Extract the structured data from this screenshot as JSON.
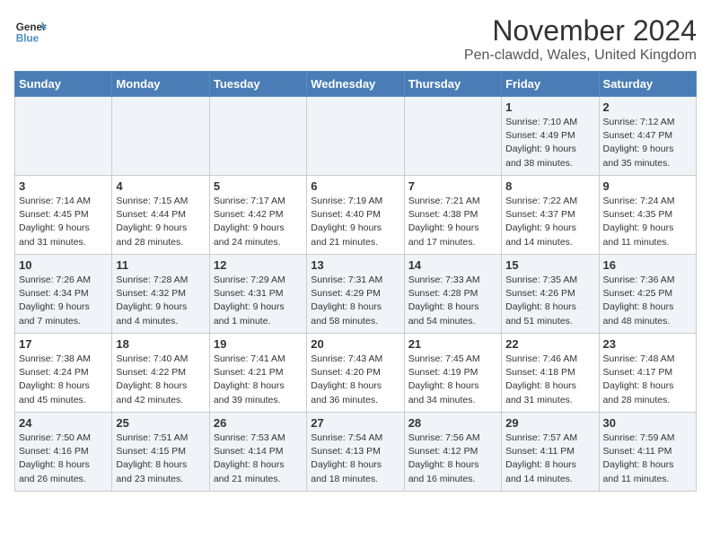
{
  "logo": {
    "line1": "General",
    "line2": "Blue"
  },
  "title": "November 2024",
  "location": "Pen-clawdd, Wales, United Kingdom",
  "days_header": [
    "Sunday",
    "Monday",
    "Tuesday",
    "Wednesday",
    "Thursday",
    "Friday",
    "Saturday"
  ],
  "weeks": [
    [
      {
        "day": "",
        "info": ""
      },
      {
        "day": "",
        "info": ""
      },
      {
        "day": "",
        "info": ""
      },
      {
        "day": "",
        "info": ""
      },
      {
        "day": "",
        "info": ""
      },
      {
        "day": "1",
        "info": "Sunrise: 7:10 AM\nSunset: 4:49 PM\nDaylight: 9 hours\nand 38 minutes."
      },
      {
        "day": "2",
        "info": "Sunrise: 7:12 AM\nSunset: 4:47 PM\nDaylight: 9 hours\nand 35 minutes."
      }
    ],
    [
      {
        "day": "3",
        "info": "Sunrise: 7:14 AM\nSunset: 4:45 PM\nDaylight: 9 hours\nand 31 minutes."
      },
      {
        "day": "4",
        "info": "Sunrise: 7:15 AM\nSunset: 4:44 PM\nDaylight: 9 hours\nand 28 minutes."
      },
      {
        "day": "5",
        "info": "Sunrise: 7:17 AM\nSunset: 4:42 PM\nDaylight: 9 hours\nand 24 minutes."
      },
      {
        "day": "6",
        "info": "Sunrise: 7:19 AM\nSunset: 4:40 PM\nDaylight: 9 hours\nand 21 minutes."
      },
      {
        "day": "7",
        "info": "Sunrise: 7:21 AM\nSunset: 4:38 PM\nDaylight: 9 hours\nand 17 minutes."
      },
      {
        "day": "8",
        "info": "Sunrise: 7:22 AM\nSunset: 4:37 PM\nDaylight: 9 hours\nand 14 minutes."
      },
      {
        "day": "9",
        "info": "Sunrise: 7:24 AM\nSunset: 4:35 PM\nDaylight: 9 hours\nand 11 minutes."
      }
    ],
    [
      {
        "day": "10",
        "info": "Sunrise: 7:26 AM\nSunset: 4:34 PM\nDaylight: 9 hours\nand 7 minutes."
      },
      {
        "day": "11",
        "info": "Sunrise: 7:28 AM\nSunset: 4:32 PM\nDaylight: 9 hours\nand 4 minutes."
      },
      {
        "day": "12",
        "info": "Sunrise: 7:29 AM\nSunset: 4:31 PM\nDaylight: 9 hours\nand 1 minute."
      },
      {
        "day": "13",
        "info": "Sunrise: 7:31 AM\nSunset: 4:29 PM\nDaylight: 8 hours\nand 58 minutes."
      },
      {
        "day": "14",
        "info": "Sunrise: 7:33 AM\nSunset: 4:28 PM\nDaylight: 8 hours\nand 54 minutes."
      },
      {
        "day": "15",
        "info": "Sunrise: 7:35 AM\nSunset: 4:26 PM\nDaylight: 8 hours\nand 51 minutes."
      },
      {
        "day": "16",
        "info": "Sunrise: 7:36 AM\nSunset: 4:25 PM\nDaylight: 8 hours\nand 48 minutes."
      }
    ],
    [
      {
        "day": "17",
        "info": "Sunrise: 7:38 AM\nSunset: 4:24 PM\nDaylight: 8 hours\nand 45 minutes."
      },
      {
        "day": "18",
        "info": "Sunrise: 7:40 AM\nSunset: 4:22 PM\nDaylight: 8 hours\nand 42 minutes."
      },
      {
        "day": "19",
        "info": "Sunrise: 7:41 AM\nSunset: 4:21 PM\nDaylight: 8 hours\nand 39 minutes."
      },
      {
        "day": "20",
        "info": "Sunrise: 7:43 AM\nSunset: 4:20 PM\nDaylight: 8 hours\nand 36 minutes."
      },
      {
        "day": "21",
        "info": "Sunrise: 7:45 AM\nSunset: 4:19 PM\nDaylight: 8 hours\nand 34 minutes."
      },
      {
        "day": "22",
        "info": "Sunrise: 7:46 AM\nSunset: 4:18 PM\nDaylight: 8 hours\nand 31 minutes."
      },
      {
        "day": "23",
        "info": "Sunrise: 7:48 AM\nSunset: 4:17 PM\nDaylight: 8 hours\nand 28 minutes."
      }
    ],
    [
      {
        "day": "24",
        "info": "Sunrise: 7:50 AM\nSunset: 4:16 PM\nDaylight: 8 hours\nand 26 minutes."
      },
      {
        "day": "25",
        "info": "Sunrise: 7:51 AM\nSunset: 4:15 PM\nDaylight: 8 hours\nand 23 minutes."
      },
      {
        "day": "26",
        "info": "Sunrise: 7:53 AM\nSunset: 4:14 PM\nDaylight: 8 hours\nand 21 minutes."
      },
      {
        "day": "27",
        "info": "Sunrise: 7:54 AM\nSunset: 4:13 PM\nDaylight: 8 hours\nand 18 minutes."
      },
      {
        "day": "28",
        "info": "Sunrise: 7:56 AM\nSunset: 4:12 PM\nDaylight: 8 hours\nand 16 minutes."
      },
      {
        "day": "29",
        "info": "Sunrise: 7:57 AM\nSunset: 4:11 PM\nDaylight: 8 hours\nand 14 minutes."
      },
      {
        "day": "30",
        "info": "Sunrise: 7:59 AM\nSunset: 4:11 PM\nDaylight: 8 hours\nand 11 minutes."
      }
    ]
  ]
}
